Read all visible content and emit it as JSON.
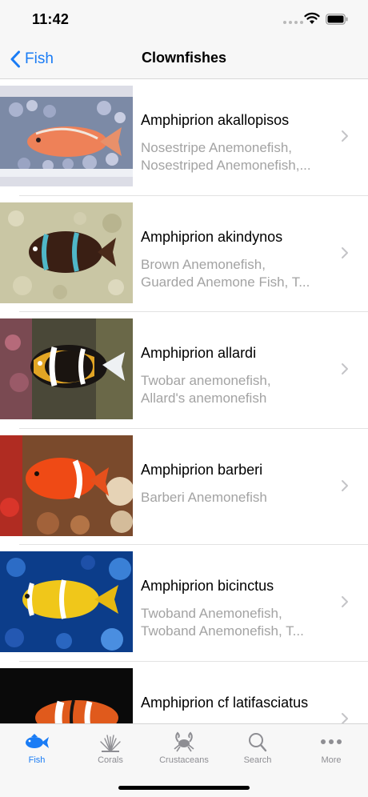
{
  "status_bar": {
    "time": "11:42"
  },
  "nav": {
    "back_label": "Fish",
    "title": "Clownfishes"
  },
  "list": {
    "items": [
      {
        "title": "Amphiprion akallopisos",
        "subtitle_lines": [
          "Nosestripe Anemonefish,",
          "Nosestriped Anemonefish,..."
        ]
      },
      {
        "title": "Amphiprion akindynos",
        "subtitle_lines": [
          "Brown Anemonefish,",
          "Guarded Anemone Fish, T..."
        ]
      },
      {
        "title": "Amphiprion allardi",
        "subtitle_lines": [
          "Twobar anemonefish,",
          "Allard's anemonefish"
        ]
      },
      {
        "title": "Amphiprion barberi",
        "subtitle_lines": [
          "Barberi Anemonefish",
          ""
        ]
      },
      {
        "title": "Amphiprion bicinctus",
        "subtitle_lines": [
          "Twoband Anemonefish,",
          "Twoband Anemonefish, T..."
        ]
      },
      {
        "title": "Amphiprion cf latifasciatus",
        "subtitle_lines": [
          "",
          ""
        ]
      }
    ]
  },
  "tab_bar": {
    "tabs": [
      {
        "label": "Fish",
        "icon": "fish-icon",
        "active": true
      },
      {
        "label": "Corals",
        "icon": "coral-icon",
        "active": false
      },
      {
        "label": "Crustaceans",
        "icon": "crab-icon",
        "active": false
      },
      {
        "label": "Search",
        "icon": "search-icon",
        "active": false
      },
      {
        "label": "More",
        "icon": "more-icon",
        "active": false
      }
    ]
  },
  "colors": {
    "accent": "#1a7cf5",
    "secondary_text": "#a3a3a3",
    "bar_background": "#f7f7f7"
  }
}
